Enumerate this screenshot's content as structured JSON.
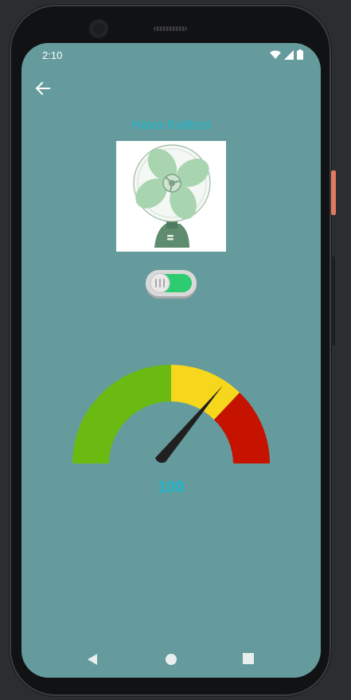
{
  "status_bar": {
    "time": "2:10"
  },
  "header": {
    "back_icon": "arrow-left-icon"
  },
  "page": {
    "title": "Hava Kalitesi"
  },
  "fan": {
    "icon": "table-fan-image"
  },
  "toggle": {
    "state": "on",
    "on_color": "#2ecc71"
  },
  "gauge": {
    "value": "100",
    "segments": [
      {
        "color": "#6aba12"
      },
      {
        "color": "#f7d71c"
      },
      {
        "color": "#c51300"
      }
    ]
  },
  "navigation": {
    "back": "nav-back-icon",
    "home": "nav-home-icon",
    "recents": "nav-recents-icon"
  },
  "colors": {
    "screen_bg": "#659b9c",
    "accent": "#1db6c9"
  }
}
